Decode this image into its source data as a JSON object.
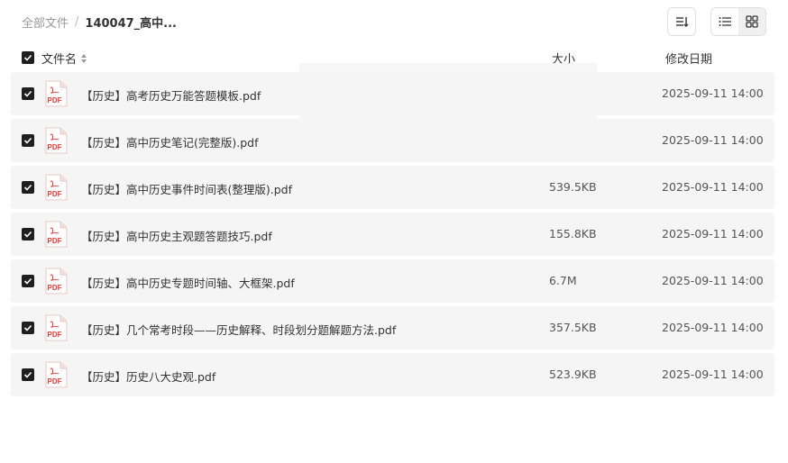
{
  "breadcrumb": {
    "root": "全部文件",
    "separator": "/",
    "current": "140047_高中..."
  },
  "icons": {
    "sort": "sort-icon",
    "list_view": "list-view-icon",
    "grid_view": "grid-view-icon",
    "checkbox": "check-icon",
    "file": "pdf-file-icon"
  },
  "header": {
    "name": "文件名",
    "size": "大小",
    "date": "修改日期"
  },
  "file_icon_label": "PDF",
  "colors": {
    "pdf_red": "#e83a3a",
    "checkbox": "#1f1f1f",
    "row_bg": "#f5f5f6"
  },
  "files": [
    {
      "name": "【历史】高考历史万能答题模板.pdf",
      "size": "",
      "date": "2025-09-11 14:00"
    },
    {
      "name": "【历史】高中历史笔记(完整版).pdf",
      "size": "",
      "date": "2025-09-11 14:00"
    },
    {
      "name": "【历史】高中历史事件时间表(整理版).pdf",
      "size": "539.5KB",
      "date": "2025-09-11 14:00"
    },
    {
      "name": "【历史】高中历史主观题答题技巧.pdf",
      "size": "155.8KB",
      "date": "2025-09-11 14:00"
    },
    {
      "name": "【历史】高中历史专题时间轴、大框架.pdf",
      "size": "6.7M",
      "date": "2025-09-11 14:00"
    },
    {
      "name": "【历史】几个常考时段——历史解释、时段划分题解题方法.pdf",
      "size": "357.5KB",
      "date": "2025-09-11 14:00"
    },
    {
      "name": "【历史】历史八大史观.pdf",
      "size": "523.9KB",
      "date": "2025-09-11 14:00"
    }
  ]
}
